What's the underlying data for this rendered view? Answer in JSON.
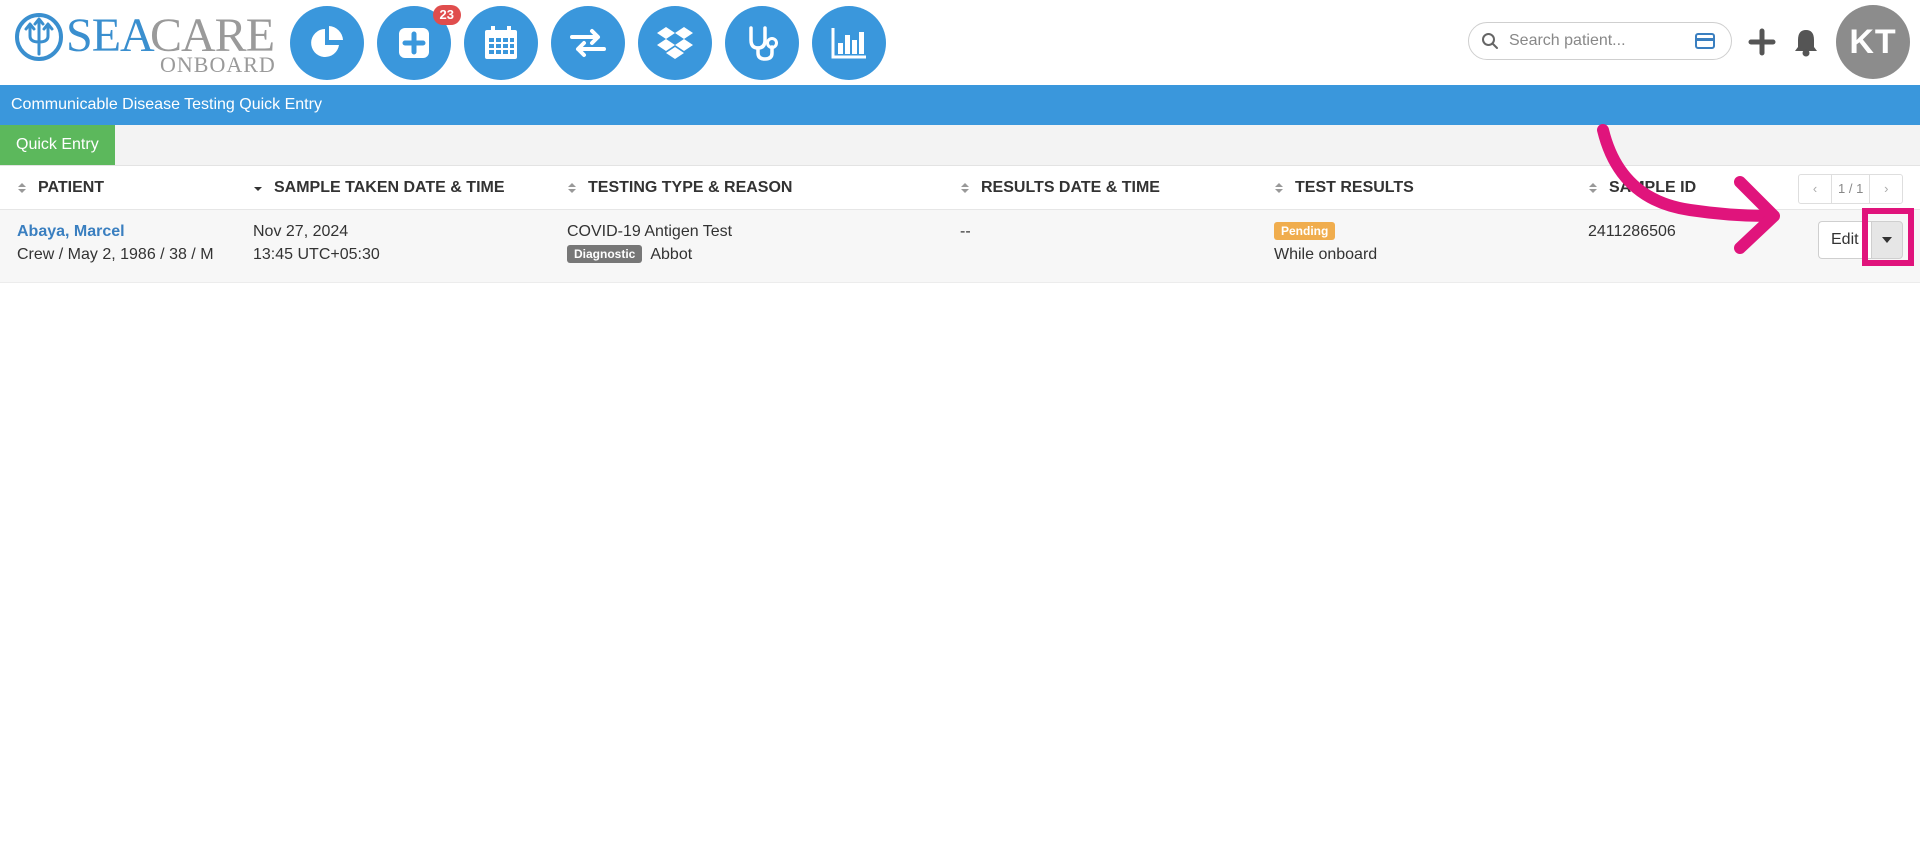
{
  "header": {
    "logo": {
      "part1": "SEA",
      "part2": "CARE",
      "sub": "ONBOARD"
    },
    "nav": [
      {
        "name": "dashboard",
        "icon": "pie-chart-icon"
      },
      {
        "name": "medical",
        "icon": "medical-plus-icon",
        "badge": "23"
      },
      {
        "name": "calendar",
        "icon": "calendar-icon"
      },
      {
        "name": "transfer",
        "icon": "exchange-icon"
      },
      {
        "name": "inventory",
        "icon": "dropbox-icon"
      },
      {
        "name": "clinic",
        "icon": "stethoscope-icon"
      },
      {
        "name": "reports",
        "icon": "bar-chart-icon"
      }
    ],
    "search": {
      "placeholder": "Search patient..."
    },
    "avatar_initials": "KT"
  },
  "page_title": "Communicable Disease Testing Quick Entry",
  "tabs": [
    {
      "label": "Quick Entry",
      "active": true
    }
  ],
  "table": {
    "columns": [
      "PATIENT",
      "SAMPLE TAKEN DATE & TIME",
      "TESTING TYPE & REASON",
      "RESULTS DATE & TIME",
      "TEST RESULTS",
      "SAMPLE ID"
    ],
    "pager": {
      "prev": "‹",
      "page": "1 / 1",
      "next": "›"
    },
    "rows": [
      {
        "patient_name": "Abaya, Marcel",
        "patient_info": "Crew / May 2, 1986 / 38 / M",
        "sample_date": "Nov 27, 2024",
        "sample_time": "13:45 UTC+05:30",
        "test_type": "COVID-19 Antigen Test",
        "reason_label": "Diagnostic",
        "reason_detail": "Abbot",
        "results_date": "--",
        "status_label": "Pending",
        "result_detail": "While onboard",
        "sample_id": "2411286506",
        "edit_label": "Edit"
      }
    ]
  },
  "colors": {
    "brand_blue": "#3a97dc",
    "success_green": "#5cb85c",
    "pending_orange": "#f0ad4e",
    "annotation_pink": "#e0147c"
  }
}
